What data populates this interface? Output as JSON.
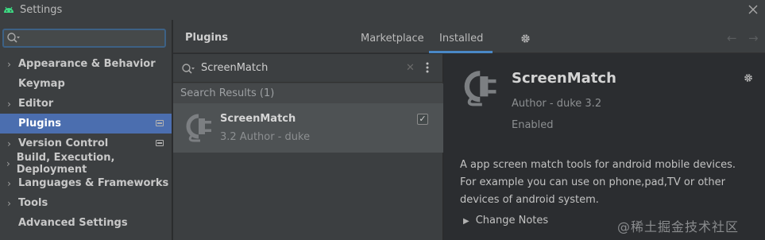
{
  "window": {
    "title": "Settings"
  },
  "sidebar": {
    "search_value": "",
    "items": [
      {
        "label": "Appearance & Behavior",
        "expandable": true,
        "selected": false,
        "badge": false
      },
      {
        "label": "Keymap",
        "expandable": false,
        "selected": false,
        "badge": false
      },
      {
        "label": "Editor",
        "expandable": true,
        "selected": false,
        "badge": false
      },
      {
        "label": "Plugins",
        "expandable": false,
        "selected": true,
        "badge": true
      },
      {
        "label": "Version Control",
        "expandable": true,
        "selected": false,
        "badge": true
      },
      {
        "label": "Build, Execution, Deployment",
        "expandable": true,
        "selected": false,
        "badge": false
      },
      {
        "label": "Languages & Frameworks",
        "expandable": true,
        "selected": false,
        "badge": false
      },
      {
        "label": "Tools",
        "expandable": true,
        "selected": false,
        "badge": false
      },
      {
        "label": "Advanced Settings",
        "expandable": false,
        "selected": false,
        "badge": false
      }
    ]
  },
  "header": {
    "title": "Plugins",
    "tabs": [
      {
        "label": "Marketplace",
        "active": false
      },
      {
        "label": "Installed",
        "active": true
      }
    ],
    "accent_color": "#4a88c7"
  },
  "plugin_list": {
    "search_value": "ScreenMatch",
    "results_label": "Search Results (1)",
    "items": [
      {
        "name": "ScreenMatch",
        "meta": "3.2  Author - duke",
        "enabled": true
      }
    ]
  },
  "detail": {
    "name": "ScreenMatch",
    "author_line": "Author - duke   3.2",
    "status": "Enabled",
    "description": "A app screen match tools for android mobile devices. For example you can use on phone,pad,TV or other devices of android system.",
    "change_notes_label": "Change Notes"
  },
  "watermark": "@稀土掘金技术社区",
  "icons": {
    "app": "android-icon",
    "close": "close-icon",
    "search": "search-icon",
    "settings": "gear-icon",
    "back": "arrow-left-icon",
    "forward": "arrow-right-icon",
    "plugin": "plug-icon",
    "more": "more-vertical-icon"
  }
}
